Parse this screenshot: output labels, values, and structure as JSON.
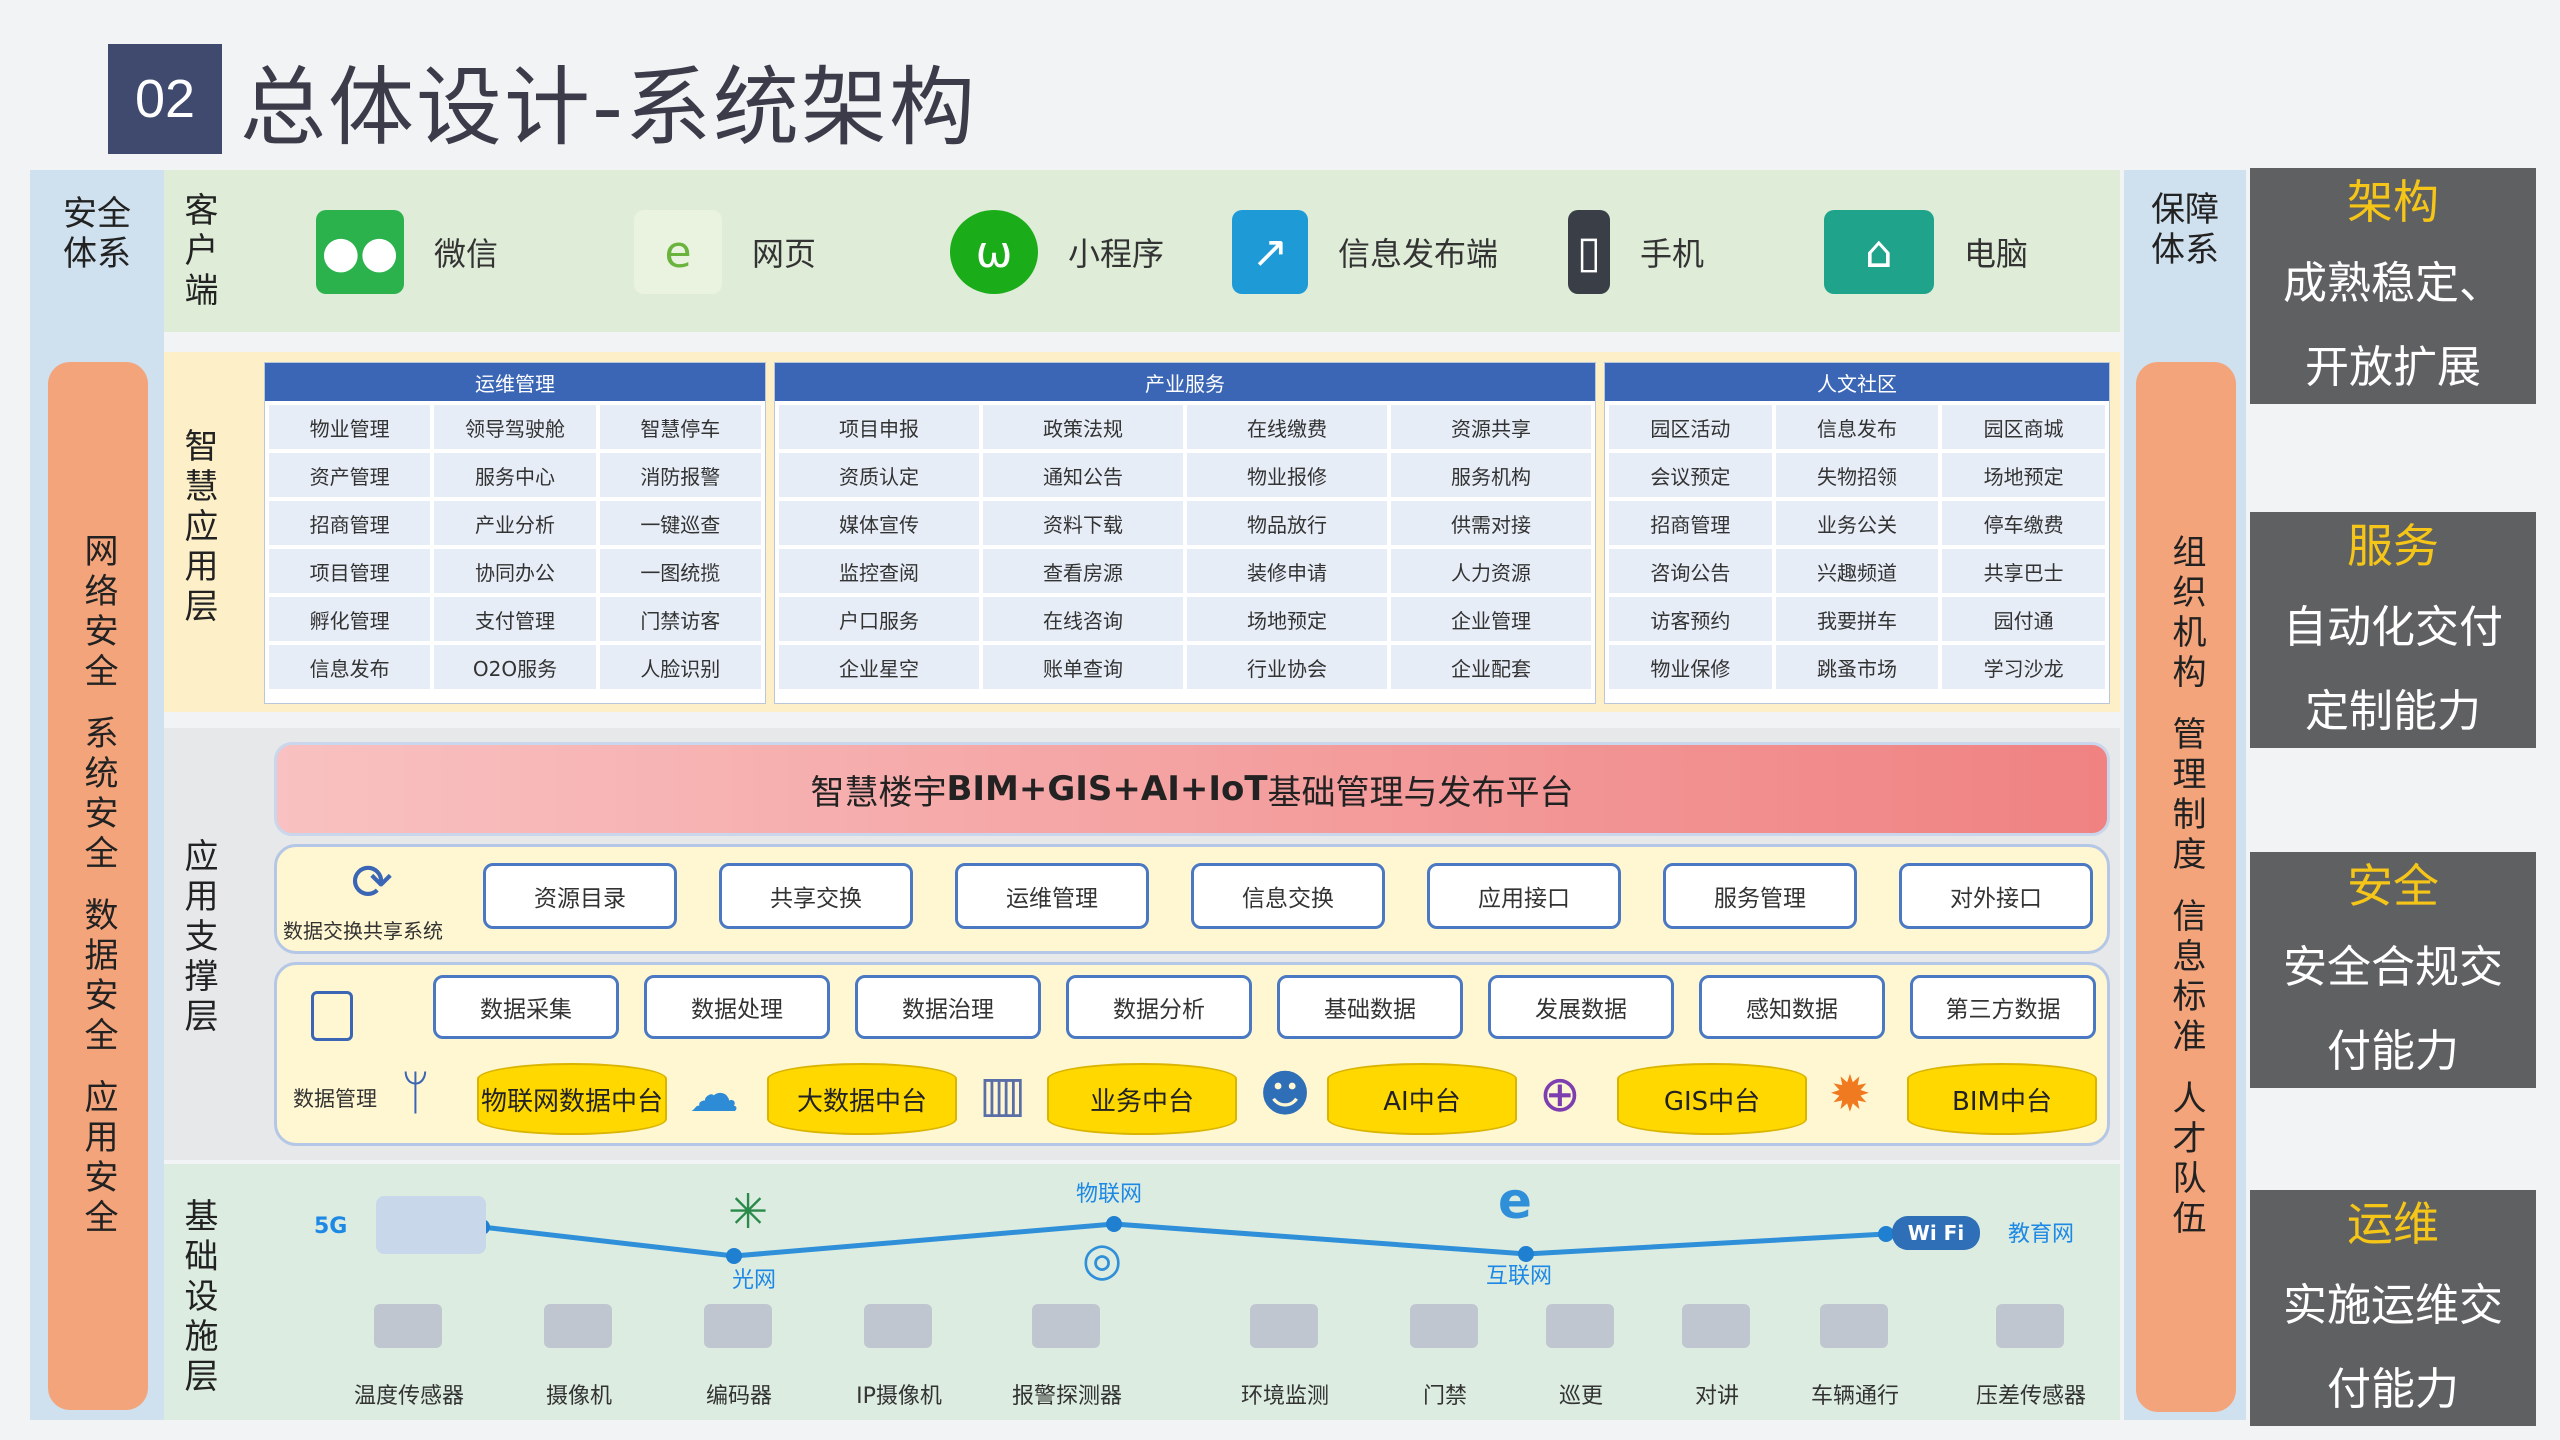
{
  "header": {
    "number": "02",
    "title": "总体设计-系统架构"
  },
  "left_column": {
    "title_line1": "安全",
    "title_line2": "体系",
    "items": [
      "网络安全",
      "系统安全",
      "数据安全",
      "应用安全"
    ]
  },
  "guarantee_column": {
    "title_line1": "保障",
    "title_line2": "体系",
    "items": [
      "组织机构",
      "管理制度",
      "信息标准",
      "人才队伍"
    ]
  },
  "client_layer": {
    "label": "客户端",
    "items": [
      {
        "label": "微信",
        "icon": "wechat-icon",
        "color": "#2bb24c"
      },
      {
        "label": "网页",
        "icon": "web-ie-icon",
        "color": "#6ab43e"
      },
      {
        "label": "小程序",
        "icon": "mini-program-icon",
        "color": "#1aad19"
      },
      {
        "label": "信息发布端",
        "icon": "info-release-icon",
        "color": "#1e9bd7"
      },
      {
        "label": "手机",
        "icon": "phone-icon",
        "color": "#3a3f47"
      },
      {
        "label": "电脑",
        "icon": "computer-icon",
        "color": "#2f3a4a"
      }
    ]
  },
  "app_layer": {
    "label": "智慧应用层",
    "groups": [
      {
        "title": "运维管理",
        "cells": [
          "物业管理",
          "领导驾驶舱",
          "智慧停车",
          "资产管理",
          "服务中心",
          "消防报警",
          "招商管理",
          "产业分析",
          "一键巡查",
          "项目管理",
          "协同办公",
          "一图统揽",
          "孵化管理",
          "支付管理",
          "门禁访客",
          "信息发布",
          "O2O服务",
          "人脸识别"
        ]
      },
      {
        "title": "产业服务",
        "cells": [
          "项目申报",
          "政策法规",
          "在线缴费",
          "资源共享",
          "资质认定",
          "通知公告",
          "物业报修",
          "服务机构",
          "媒体宣传",
          "资料下载",
          "物品放行",
          "供需对接",
          "监控查阅",
          "查看房源",
          "装修申请",
          "人力资源",
          "户口服务",
          "在线咨询",
          "场地预定",
          "企业管理",
          "企业星空",
          "账单查询",
          "行业协会",
          "企业配套"
        ]
      },
      {
        "title": "人文社区",
        "cells": [
          "园区活动",
          "信息发布",
          "园区商城",
          "会议预定",
          "失物招领",
          "场地预定",
          "招商管理",
          "业务公关",
          "停车缴费",
          "咨询公告",
          "兴趣频道",
          "共享巴士",
          "访客预约",
          "我要拼车",
          "园付通",
          "物业保修",
          "跳蚤市场",
          "学习沙龙"
        ]
      }
    ]
  },
  "support_layer": {
    "label": "应用支撑层",
    "platform_prefix": "智慧楼宇",
    "platform_bold": "BIM+GIS+AI+IoT",
    "platform_suffix": "基础管理与发布平台",
    "exchange_label": "数据交换共享系统",
    "exchange_items": [
      "资源目录",
      "共享交换",
      "运维管理",
      "信息交换",
      "应用接口",
      "服务管理",
      "对外接口"
    ],
    "data_mgmt_label": "数据管理",
    "data_items": [
      "数据采集",
      "数据处理",
      "数据治理",
      "数据分析",
      "基础数据",
      "发展数据",
      "感知数据",
      "第三方数据"
    ],
    "platforms": [
      "物联网数据中台",
      "大数据中台",
      "业务中台",
      "AI中台",
      "GIS中台",
      "BIM中台"
    ]
  },
  "infra_layer": {
    "label": "基础设施层",
    "networks": [
      "5G",
      "光网",
      "物联网",
      "互联网",
      "教育网"
    ],
    "wifi_label": "Wi Fi",
    "devices": [
      "温度传感器",
      "摄像机",
      "编码器",
      "IP摄像机",
      "报警探测器",
      "环境监测",
      "门禁",
      "巡更",
      "对讲",
      "车辆通行",
      "压差传感器"
    ]
  },
  "right_cards": [
    {
      "heading": "架构",
      "line1": "成熟稳定、",
      "line2": "开放扩展"
    },
    {
      "heading": "服务",
      "line1": "自动化交付",
      "line2": "定制能力"
    },
    {
      "heading": "安全",
      "line1": "安全合规交",
      "line2": "付能力"
    },
    {
      "heading": "运维",
      "line1": "实施运维交",
      "line2": "付能力"
    }
  ],
  "colors": {
    "accent_blue": "#3b66b5",
    "orange": "#f3a47b",
    "card_gray": "#5f6062",
    "gold": "#f5c518",
    "platform_yellow": "#ffd800"
  }
}
